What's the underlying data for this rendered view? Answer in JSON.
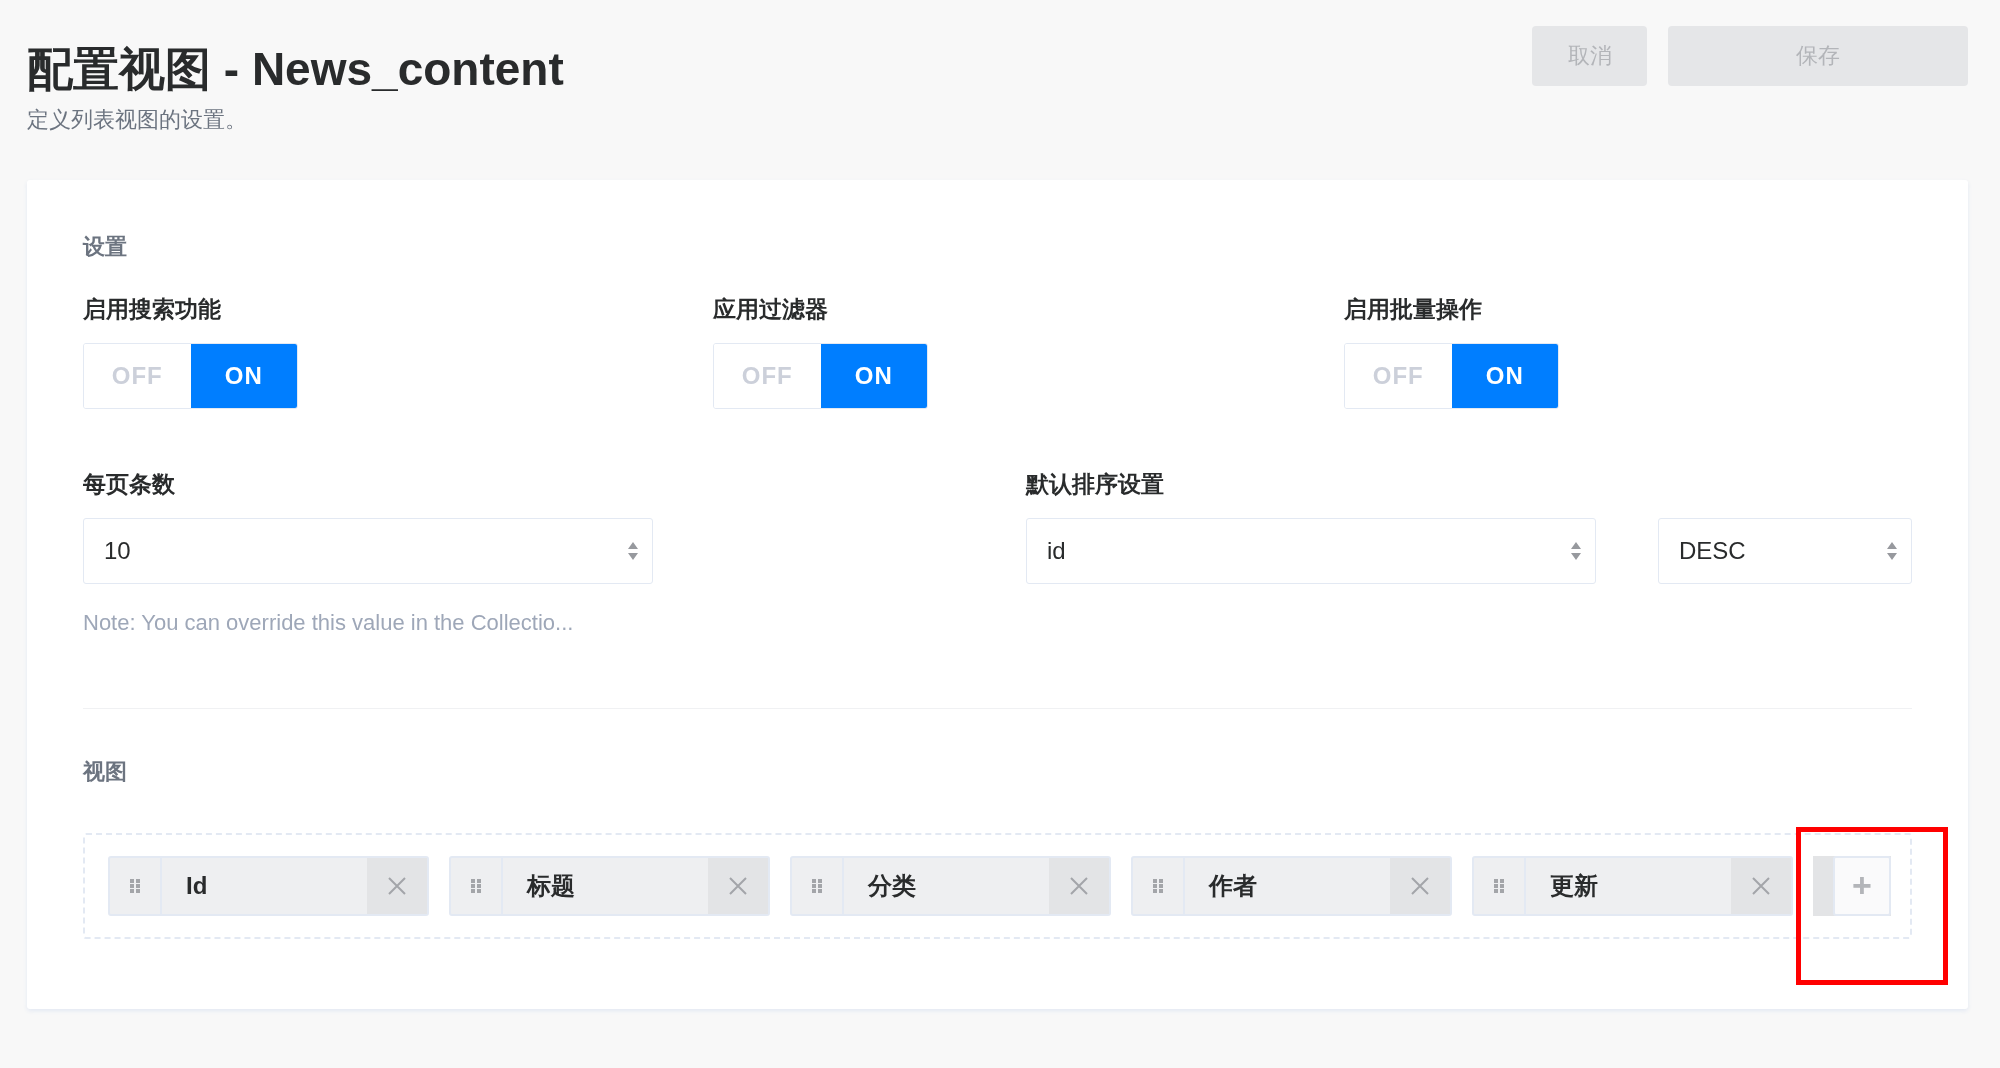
{
  "header": {
    "title": "配置视图 - News_content",
    "subtitle": "定义列表视图的设置。"
  },
  "actions": [
    {
      "label": "取消",
      "kind": "cancel",
      "disabled": true
    },
    {
      "label": "保存",
      "kind": "save",
      "disabled": true
    }
  ],
  "settings": {
    "heading": "设置",
    "toggles": [
      {
        "label": "启用搜索功能",
        "off_label": "OFF",
        "on_label": "ON",
        "on": true
      },
      {
        "label": "应用过滤器",
        "off_label": "OFF",
        "on_label": "ON",
        "on": true
      },
      {
        "label": "启用批量操作",
        "off_label": "OFF",
        "on_label": "ON",
        "on": true
      }
    ],
    "page_size": {
      "label": "每页条数",
      "value": "10",
      "note": "Note: You can override this value in the Collectio..."
    },
    "sort": {
      "label": "默认排序设置",
      "field": "id",
      "order": "DESC"
    }
  },
  "view": {
    "heading": "视图",
    "fields": [
      {
        "label": "Id"
      },
      {
        "label": "标题"
      },
      {
        "label": "分类"
      },
      {
        "label": "作者"
      },
      {
        "label": "更新"
      }
    ],
    "add_button": "+",
    "highlighted": true
  }
}
